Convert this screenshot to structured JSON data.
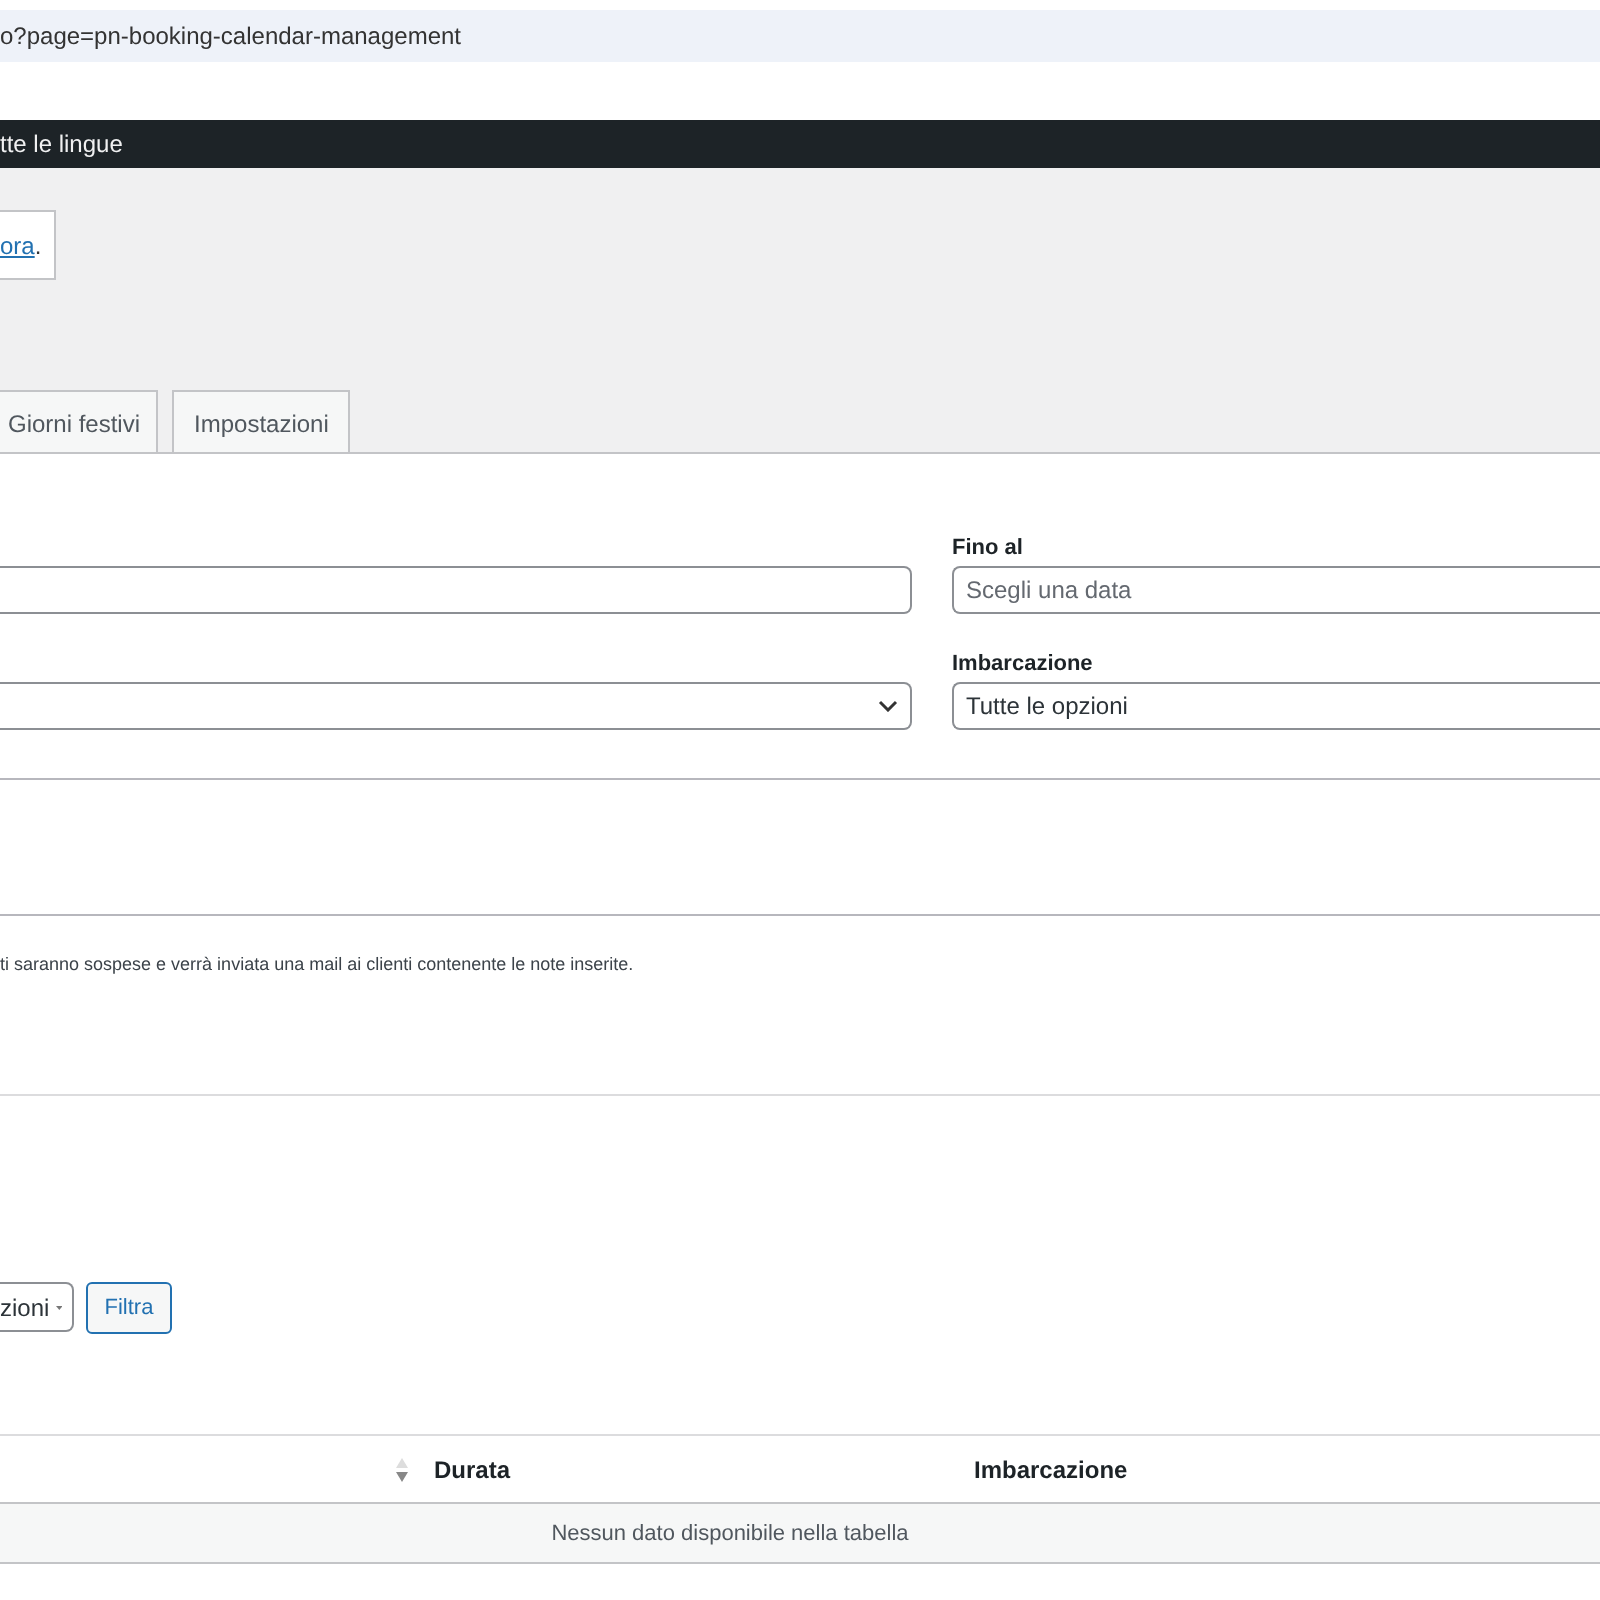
{
  "address_bar": {
    "url": "o?page=pn-booking-calendar-management"
  },
  "admin_bar": {
    "text": "tte le lingue"
  },
  "notice": {
    "link": "ora",
    "after": "."
  },
  "tabs": [
    {
      "label": "Giorni festivi",
      "selected": false
    },
    {
      "label": "Impostazioni",
      "selected": false
    }
  ],
  "filters": [
    {
      "kind": "date",
      "label": "Fino al",
      "placeholder": "Scegli una data"
    },
    {
      "kind": "select",
      "label": "Imbarcazione",
      "value": "Tutte le opzioni"
    }
  ],
  "note": "ti saranno sospese e verrà inviata una mail ai clienti contenente le note inserite.",
  "table_filter": {
    "select_value": "zioni",
    "button": "Filtra"
  },
  "table": {
    "columns": [
      {
        "label": "Durata",
        "sortable": true
      },
      {
        "label": "Imbarcazione",
        "sortable": false
      }
    ],
    "empty_message": "Nessun dato disponibile nella tabella"
  }
}
